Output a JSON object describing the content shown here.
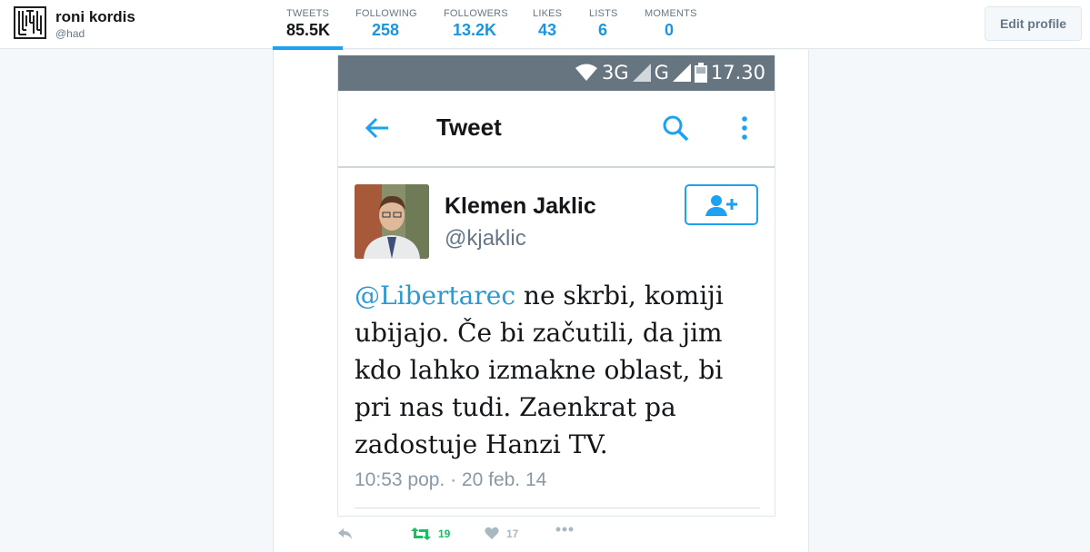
{
  "profile": {
    "name": "roni kordis",
    "handle": "@had"
  },
  "nav": [
    {
      "label": "TWEETS",
      "value": "85.5K",
      "active": true
    },
    {
      "label": "FOLLOWING",
      "value": "258"
    },
    {
      "label": "FOLLOWERS",
      "value": "13.2K"
    },
    {
      "label": "LIKES",
      "value": "43"
    },
    {
      "label": "LISTS",
      "value": "6"
    },
    {
      "label": "MOMENTS",
      "value": "0"
    }
  ],
  "edit_profile_label": "Edit profile",
  "phone": {
    "status": {
      "network1": "3G",
      "network2": "G",
      "time": "17.30"
    },
    "app_title": "Tweet",
    "tweet": {
      "author_name": "Klemen Jaklic",
      "author_handle": "@kjaklic",
      "mention": "@Libertarec",
      "text": " ne skrbi, komiji ubijajo. Če bi začutili, da jim kdo lahko izmakne oblast, bi pri nas tudi. Zaenkrat pa zadostuje Hanzi TV.",
      "timestamp": "10:53 pop. · 20 feb. 14"
    }
  },
  "actions": {
    "retweets": "19",
    "likes": "17"
  },
  "colors": {
    "accent": "#1da1f2",
    "link": "#1b95e0",
    "retweet": "#17bf63",
    "statusbar": "#66757f"
  },
  "icons": [
    "back-arrow-icon",
    "search-icon",
    "more-vertical-icon",
    "follow-icon",
    "reply-icon",
    "retweet-icon",
    "heart-icon",
    "more-dots-icon",
    "wifi-icon",
    "signal-icon",
    "battery-icon"
  ]
}
